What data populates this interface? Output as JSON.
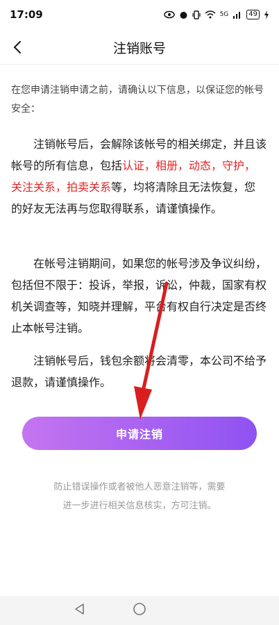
{
  "status_bar": {
    "time": "17:09",
    "signal_label": "5G",
    "battery_level": "49"
  },
  "nav": {
    "title": "注销账号"
  },
  "intro": {
    "text": "在您申请注销申请之前，请确认以下信息，以保证您的帐号安全："
  },
  "paragraph1": {
    "lead": "注销帐号后，会解除该帐号的相关绑定，并且该帐号的所有信息，包括",
    "highlight": "认证，相册，动态，守护，关注关系，拍卖关系",
    "tail": "等，均将清除且无法恢复，您的好友无法再与您取得联系，请谨慎操作。"
  },
  "paragraph2": {
    "text": "在帐号注销期间，如果您的帐号涉及争议纠纷，包括但不限于：投诉，举报，诉讼，仲裁，国家有权机关调查等，知晓并理解，平台有权自行决定是否终止本帐号注销。"
  },
  "paragraph3": {
    "text": "注销帐号后，钱包余额将会清零，本公司不给予退款，请谨慎操作。"
  },
  "apply_button": {
    "label": "申请注销"
  },
  "note": {
    "line1": "防止错误操作或者被他人恶意注销等，需要",
    "line2": "进一步进行相关信息核实，方可注销。"
  },
  "colors": {
    "highlight": "#e42525",
    "button_start": "#c475f0",
    "button_end": "#8f52f2",
    "arrow": "#d81e1e"
  }
}
